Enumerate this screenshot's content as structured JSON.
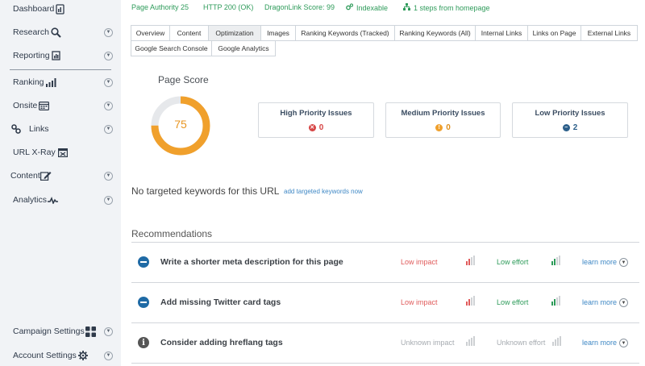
{
  "sidebar": {
    "items": [
      {
        "label": "Dashboard",
        "icon": "dashboard-icon"
      },
      {
        "label": "Research",
        "icon": "search-icon"
      },
      {
        "label": "Reporting",
        "icon": "report-icon"
      },
      {
        "label": "Ranking",
        "icon": "bar-chart-icon"
      },
      {
        "label": "Onsite",
        "icon": "calendar-grid-icon"
      },
      {
        "label": "Links",
        "icon": "link-icon"
      },
      {
        "label": "URL X-Ray",
        "icon": "xray-icon"
      },
      {
        "label": "Content",
        "icon": "edit-icon"
      },
      {
        "label": "Analytics",
        "icon": "pulse-icon"
      },
      {
        "label": "Campaign Settings",
        "icon": "grid-icon"
      },
      {
        "label": "Account Settings",
        "icon": "gear-icon"
      }
    ]
  },
  "metrics": {
    "page_authority": "Page Authority 25",
    "http_status": "HTTP 200 (OK)",
    "dragonlink": "DragonLink Score: 99",
    "indexable": "Indexable",
    "steps": "1 steps from homepage"
  },
  "tabs": [
    "Overview",
    "Content",
    "Optimization",
    "Images",
    "Ranking Keywords (Tracked)",
    "Ranking Keywords (All)",
    "Internal Links",
    "Links on Page",
    "External Links",
    "Google Search Console",
    "Google Analytics"
  ],
  "active_tab": "Optimization",
  "page_score": {
    "title": "Page Score",
    "value": "75",
    "fraction": 0.75,
    "color": "#f0a02c",
    "track_color": "#e6e8eb"
  },
  "issues": [
    {
      "title": "High Priority Issues",
      "count": "0",
      "color": "#d64545",
      "symbol": "✕"
    },
    {
      "title": "Medium Priority Issues",
      "count": "0",
      "color": "#f0a02c",
      "symbol": "!"
    },
    {
      "title": "Low Priority Issues",
      "count": "2",
      "color": "#2c5f8a",
      "symbol": "−"
    }
  ],
  "keywords": {
    "message": "No targeted keywords for this URL",
    "link": "add targeted keywords now"
  },
  "recommendations": {
    "title": "Recommendations",
    "items": [
      {
        "text": "Write a shorter meta description for this page",
        "impact": "Low impact",
        "effort": "Low effort",
        "learn": "learn more",
        "type": "minus"
      },
      {
        "text": "Add missing Twitter card tags",
        "impact": "Low impact",
        "effort": "Low effort",
        "learn": "learn more",
        "type": "minus"
      },
      {
        "text": "Consider adding hreflang tags",
        "impact": "Unknown impact",
        "effort": "Unknown effort",
        "learn": "learn more",
        "type": "info"
      }
    ]
  },
  "colors": {
    "green": "#2e9b5a",
    "red": "#e05b5b",
    "link": "#3f88c5",
    "grey": "#a6abb0"
  }
}
